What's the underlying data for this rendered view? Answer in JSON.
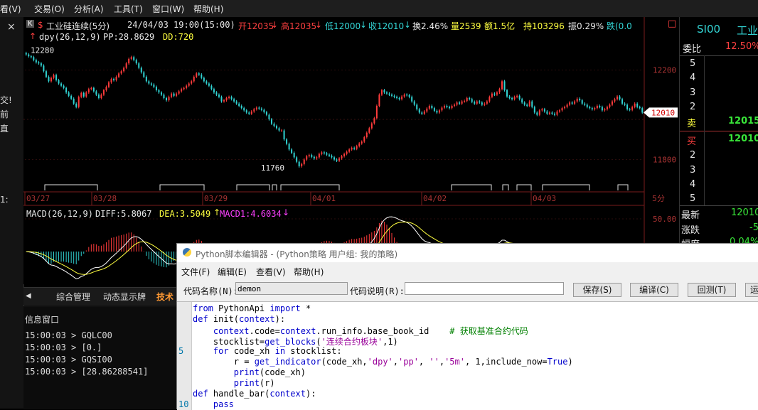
{
  "menubar": {
    "items": [
      "看(V)",
      "交易(O)",
      "分析(A)",
      "工具(T)",
      "窗口(W)",
      "帮助(H)"
    ]
  },
  "left_column": {
    "close_glyph": "×",
    "labels": [
      "交!",
      "前",
      "直",
      "1:"
    ]
  },
  "chart_header": {
    "k_badge": "K",
    "dollar": "$",
    "title": "工业硅连续(5分)",
    "datetime": "24/04/03 19:00(15:00)",
    "open": "开12035",
    "high": "高12035",
    "low": "低12000",
    "close": "收12010",
    "turnover_rate": "换2.46%",
    "volume": "量2539",
    "amount": "额1.5亿",
    "open_interest": "持103296",
    "amplitude": "振0.29%",
    "extra": "跌(0.0"
  },
  "indicator_row": {
    "label": "dpy(26,12,9)",
    "pp": "PP:28.8629",
    "dd": "DD:720"
  },
  "chart_data": [
    {
      "type": "candlestick",
      "title": "工业硅连续(5分)",
      "price_ticks": [
        "12200",
        "11800"
      ],
      "last_price_tag": "12010",
      "high_annotation": "12280",
      "low_annotation": "11760",
      "date_labels": [
        "03/27",
        "03/28",
        "03/29",
        "04/01",
        "04/02",
        "04/03"
      ],
      "period_label": "5分",
      "close": [
        12270,
        12262,
        12258,
        12245,
        12235,
        12230,
        12220,
        12195,
        12170,
        12150,
        12165,
        12178,
        12155,
        12140,
        12130,
        12120,
        12100,
        12085,
        12072,
        12050,
        12035,
        12080,
        12098,
        12082,
        12100,
        12115,
        12120,
        12105,
        12090,
        12075,
        12090,
        12110,
        12125,
        12145,
        12160,
        12155,
        12170,
        12185,
        12195,
        12210,
        12230,
        12250,
        12258,
        12245,
        12230,
        12210,
        12190,
        12170,
        12150,
        12140,
        12135,
        12125,
        12110,
        12100,
        12090,
        12075,
        12065,
        12080,
        12095,
        12085,
        12095,
        12105,
        12115,
        12120,
        12130,
        12140,
        12150,
        12170,
        12185,
        12180,
        12165,
        12150,
        12140,
        12130,
        12115,
        12100,
        12090,
        12080,
        12060,
        12065,
        12075,
        12080,
        12070,
        12060,
        12050,
        12040,
        12030,
        12020,
        12010,
        12005,
        12015,
        12025,
        12032,
        12028,
        12022,
        12012,
        12000,
        11980,
        11960,
        11950,
        11940,
        11930,
        11930,
        11890,
        11870,
        11845,
        11830,
        11810,
        11790,
        11770,
        11780,
        11800,
        11815,
        11820,
        11812,
        11805,
        11810,
        11825,
        11832,
        11828,
        11822,
        11817,
        11810,
        11800,
        11795,
        11805,
        11815,
        11825,
        11835,
        11845,
        11852,
        11848,
        11860,
        11872,
        11880,
        11900,
        11920,
        11940,
        11962,
        11985,
        12040,
        12090,
        12110,
        12100,
        12095,
        12090,
        12085,
        12080,
        12075,
        12070,
        12082,
        12090,
        12088,
        12080,
        12060,
        12045,
        12025,
        12010,
        12005,
        12015,
        12028,
        12040,
        12030,
        12018,
        12010,
        12020,
        12032,
        12040,
        12035,
        12030,
        12040,
        12045,
        12055,
        12050,
        12060,
        12062,
        12075,
        12070,
        12058,
        12050,
        12060,
        12055,
        12045,
        12050,
        12060,
        12080,
        12095,
        12090,
        12100,
        12115,
        12150,
        12110,
        12082,
        12075,
        12070,
        12080,
        12085,
        12070,
        12055,
        12045,
        12040,
        12060,
        12035,
        12010,
        12000,
        12020,
        12025,
        12015,
        12005,
        12010,
        12005,
        12000,
        12015,
        12020,
        12030,
        12035,
        12045,
        12055,
        12050,
        12060,
        12072,
        12065,
        12050,
        12045,
        12035,
        12030,
        12025,
        12030,
        12040,
        12035,
        12020,
        12025,
        12035,
        12045,
        12060,
        12070,
        12082,
        12070,
        12050,
        12045,
        12025,
        12022,
        12035,
        12050,
        12035,
        12030,
        12010
      ],
      "ylim": [
        11700,
        12310
      ]
    },
    {
      "type": "line",
      "title": "MACD(26,12,9)",
      "diff": "DIFF:5.8067",
      "dea": "DEA:3.5049",
      "macd": "MACD1:4.6034",
      "tick": "50.00"
    }
  ],
  "side_panel": {
    "symbol": "SI00",
    "name": "工业",
    "weibi_label": "委比",
    "weibi_value": "12.50%",
    "sell_levels": [
      "5",
      "4",
      "3",
      "2"
    ],
    "sell_label": "卖",
    "sell_price": "12015",
    "buy_label": "买",
    "buy_price": "12010",
    "buy_levels": [
      "2",
      "3",
      "4",
      "5"
    ],
    "latest_label": "最新",
    "latest_value": "12010",
    "change_label": "涨跌",
    "change_value": "-5",
    "amp_label": "幅度",
    "amp_value": "0.04%"
  },
  "bottom_tabs": {
    "arrow": "◀",
    "items": [
      "综合管理",
      "动态显示牌",
      "技术"
    ]
  },
  "info_window": {
    "title": "信息窗口",
    "lines": [
      "15:00:03 > GQLC00",
      "15:00:03 > [0.]",
      "15:00:03 > GQSI00",
      "15:00:03 > [28.86288541]"
    ]
  },
  "editor": {
    "title": "Python脚本编辑器 - (Python策略 用户组: 我的策略)",
    "menu": [
      "文件(F)",
      "编辑(E)",
      "查看(V)",
      "帮助(H)"
    ],
    "code_name_label": "代码名称(N):",
    "code_name_value": "demon",
    "code_desc_label": "代码说明(R):",
    "code_desc_value": "",
    "buttons": [
      "保存(S)",
      "编译(C)",
      "回测(T)",
      "运"
    ],
    "line_numbers": [
      "5",
      "10"
    ]
  }
}
